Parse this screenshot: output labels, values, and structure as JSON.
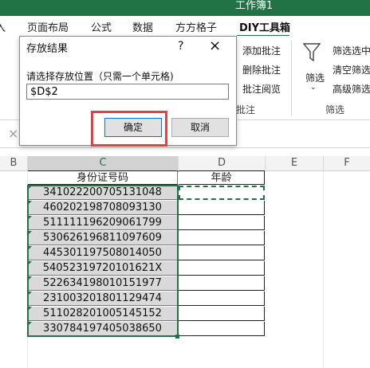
{
  "window": {
    "title": "工作簿1"
  },
  "ribbon_tabs": [
    "入",
    "页面布局",
    "公式",
    "数据",
    "方方格子",
    "DIY工具箱"
  ],
  "ribbon": {
    "items_col1": [
      "添加批注",
      "删除批注",
      "批注阅览"
    ],
    "group_label": "批注",
    "filter_label": "筛选",
    "filter_group": "筛选",
    "items_col3": [
      "筛选选中",
      "清空筛选",
      "高级筛选"
    ]
  },
  "formula_bar": {
    "cancel": "×"
  },
  "columns": [
    "B",
    "C",
    "D",
    "E",
    "F"
  ],
  "sheet": {
    "header_c": "身份证号码",
    "header_d": "年龄",
    "ids": [
      "341022200705131048",
      "460202198708093130",
      "511111196209061799",
      "530626196811097609",
      "445301197508014050",
      "54052319720101621X",
      "522634198010151977",
      "231003201801129474",
      "511028201005145152",
      "330784197405038650"
    ]
  },
  "dialog": {
    "title": "存放结果",
    "help": "?",
    "close": "×",
    "prompt": "请选择存放位置（只需一个单元格)",
    "input_value": "$D$2",
    "ok": "确定",
    "cancel": "取消"
  },
  "colors": {
    "accent": "#217346",
    "highlight": "#e14242"
  }
}
